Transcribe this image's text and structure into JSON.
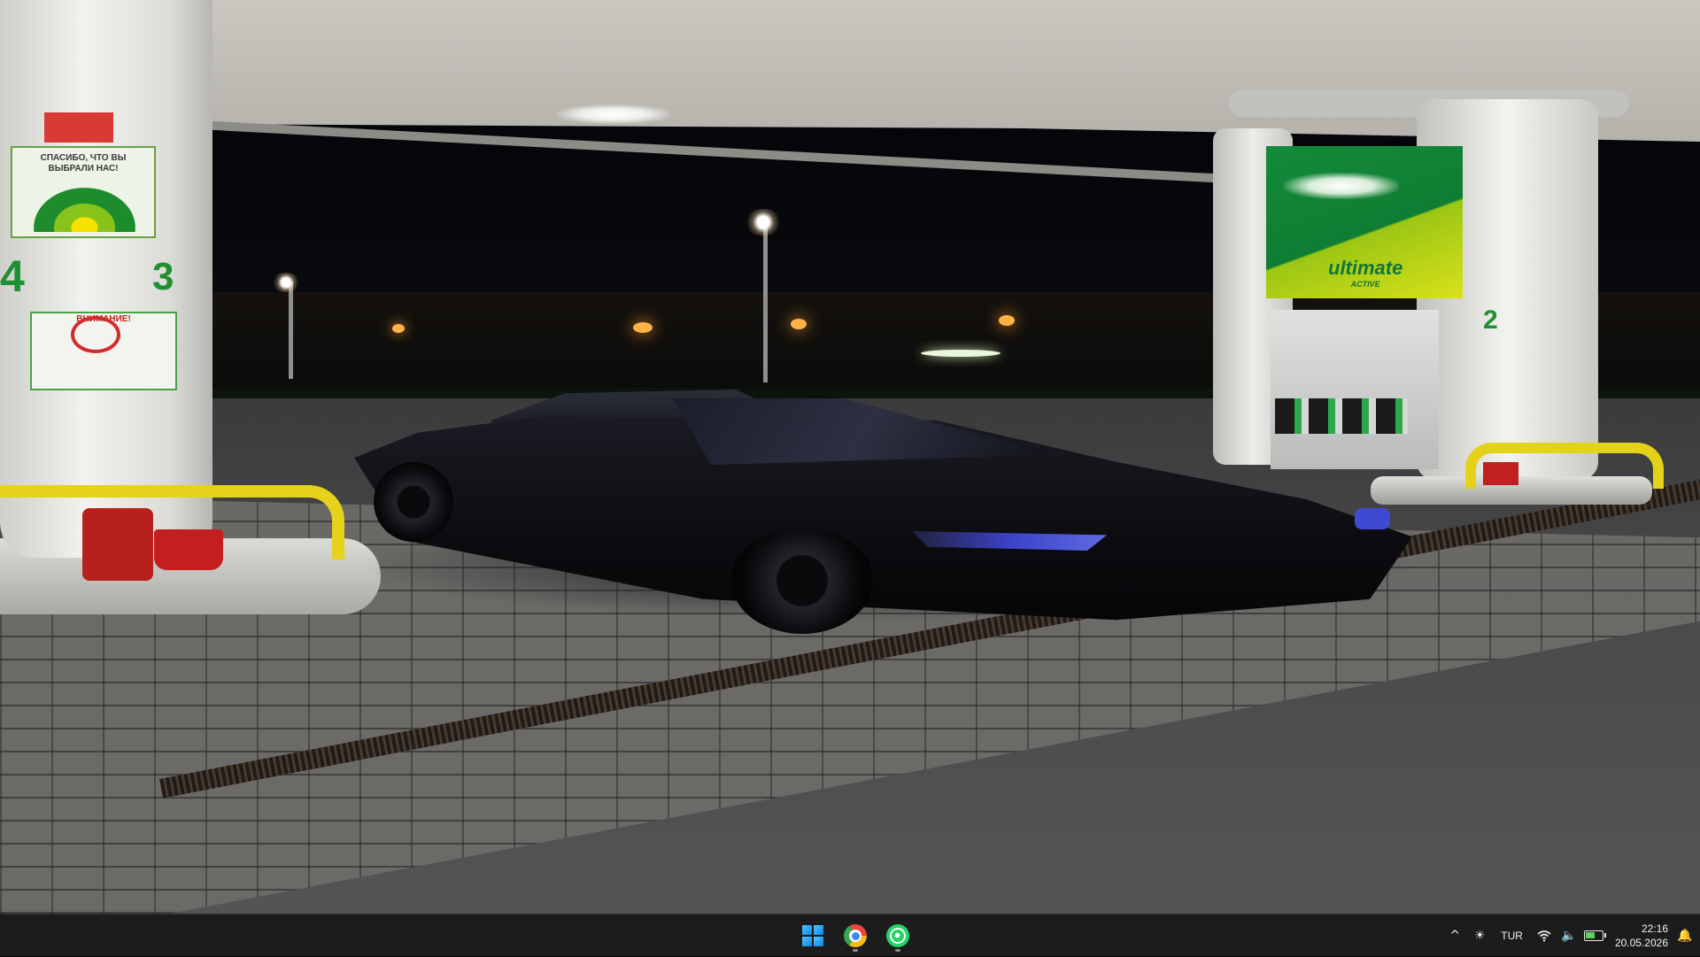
{
  "wallpaper": {
    "sign_thanks": "СПАСИБО, ЧТО ВЫ ВЫБРАЛИ НАС!",
    "sign_warning": "ВНИМАНИЕ!",
    "pump_numbers": [
      "4",
      "3",
      "2"
    ],
    "panel_brand": "ultimate",
    "panel_sub": "ACTIVE"
  },
  "taskbar": {
    "pinned": [
      {
        "name": "start-button",
        "icon": "windows-logo-icon"
      },
      {
        "name": "chrome-app",
        "icon": "chrome-icon",
        "running": true
      },
      {
        "name": "whatsapp-app",
        "icon": "whatsapp-icon",
        "running": true
      }
    ],
    "tray": {
      "overflow_icon": "^",
      "brightness_icon": "☀",
      "language": "TUR",
      "wifi_icon": "wifi-icon",
      "volume_icon": "🔈",
      "battery_level": 0.6,
      "time": "22:16",
      "date": "20.05.2026",
      "notification_icon": "🔔"
    }
  }
}
